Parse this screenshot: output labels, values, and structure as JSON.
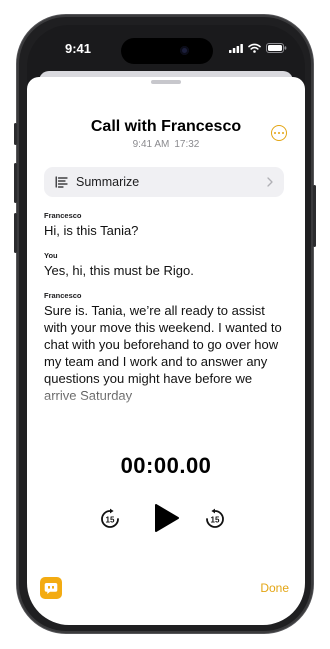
{
  "status_bar": {
    "time": "9:41",
    "icons": [
      "cellular-signal-icon",
      "wifi-icon",
      "battery-icon"
    ]
  },
  "call": {
    "title": "Call with Francesco",
    "time": "9:41 AM",
    "duration": "17:32",
    "more_icon": "ellipsis-circle-icon"
  },
  "summarize": {
    "label": "Summarize",
    "icon": "list-sparkle-icon"
  },
  "transcript": [
    {
      "speaker": "Francesco",
      "text": "Hi, is this Tania?"
    },
    {
      "speaker": "You",
      "text": "Yes, hi, this must be Rigo."
    },
    {
      "speaker": "Francesco",
      "text": "Sure is. Tania, we’re all ready to assist with your move this weekend. I wanted to chat with you beforehand to go over how my team and I work and to answer any questions you might have before we arrive Saturday"
    }
  ],
  "player": {
    "timer": "00:00.00",
    "skip_back_label": "15",
    "skip_forward_label": "15"
  },
  "bottom": {
    "done_label": "Done"
  },
  "colors": {
    "accent": "#E3A514",
    "sheet_background": "#FFFFFF",
    "device_frame": "#1F1F21"
  }
}
